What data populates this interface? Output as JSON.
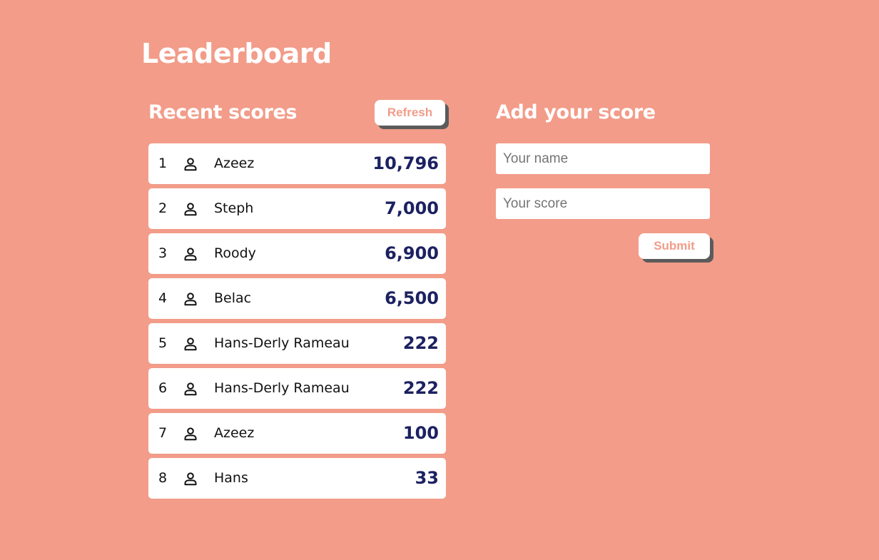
{
  "page": {
    "title": "Leaderboard"
  },
  "theme": {
    "background": "#f29c89",
    "card": "#ffffff",
    "score_color": "#1c2161",
    "button_text": "#f29c89",
    "button_shadow": "#5b5b5b"
  },
  "recent_scores": {
    "title": "Recent scores",
    "refresh_label": "Refresh",
    "entries": [
      {
        "rank": "1",
        "name": "Azeez",
        "score": "10,796",
        "icon": "person-icon"
      },
      {
        "rank": "2",
        "name": "Steph",
        "score": "7,000",
        "icon": "person-icon"
      },
      {
        "rank": "3",
        "name": "Roody",
        "score": "6,900",
        "icon": "person-icon"
      },
      {
        "rank": "4",
        "name": "Belac",
        "score": "6,500",
        "icon": "person-icon"
      },
      {
        "rank": "5",
        "name": "Hans-Derly Rameau",
        "score": "222",
        "icon": "person-icon"
      },
      {
        "rank": "6",
        "name": "Hans-Derly Rameau",
        "score": "222",
        "icon": "person-icon"
      },
      {
        "rank": "7",
        "name": "Azeez",
        "score": "100",
        "icon": "person-icon"
      },
      {
        "rank": "8",
        "name": "Hans",
        "score": "33",
        "icon": "person-icon"
      }
    ]
  },
  "add_score": {
    "title": "Add your score",
    "name_placeholder": "Your name",
    "name_value": "",
    "score_placeholder": "Your score",
    "score_value": "",
    "submit_label": "Submit"
  }
}
